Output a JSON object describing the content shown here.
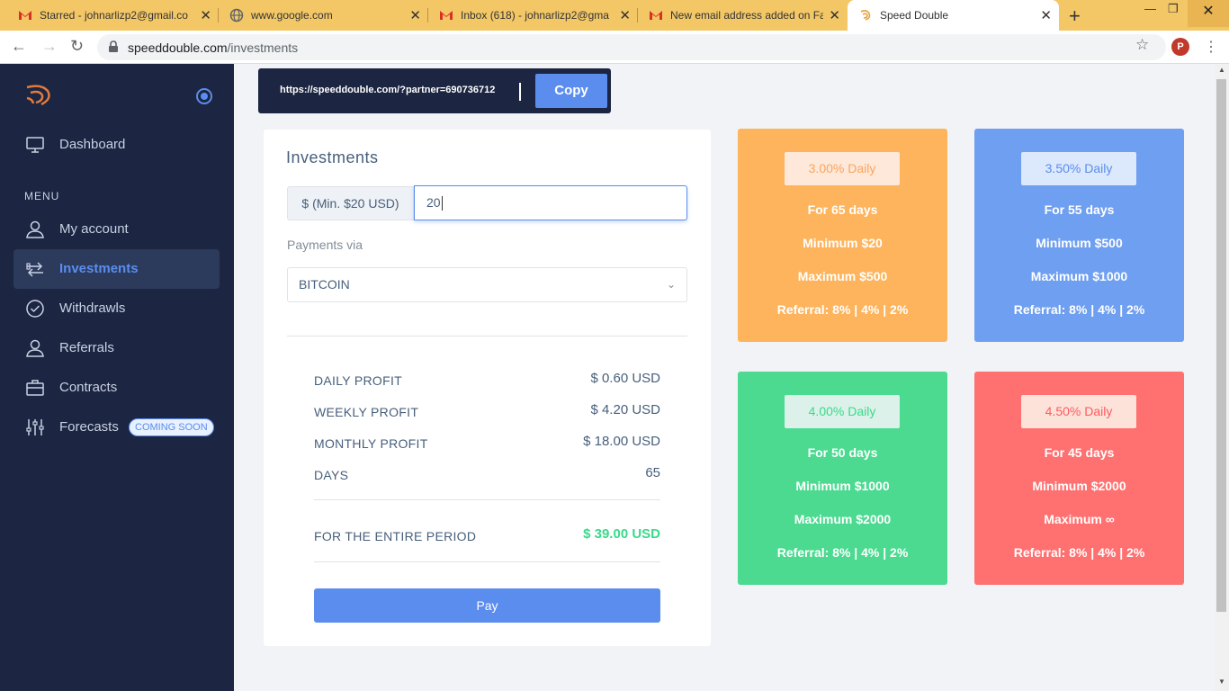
{
  "browser": {
    "tabs": [
      {
        "title": "Starred - johnarlizp2@gmail.co",
        "icon": "gmail-icon"
      },
      {
        "title": "www.google.com",
        "icon": "globe-icon"
      },
      {
        "title": "Inbox (618) - johnarlizp2@gma",
        "icon": "gmail-icon"
      },
      {
        "title": "New email address added on Fa",
        "icon": "gmail-icon"
      },
      {
        "title": "Speed Double",
        "icon": "speeddouble-icon"
      }
    ],
    "url_host": "speeddouble.com",
    "url_path": "/investments",
    "profile_initial": "P"
  },
  "sidebar": {
    "dashboard": "Dashboard",
    "menu_title": "MENU",
    "items": [
      {
        "label": "My account"
      },
      {
        "label": "Investments"
      },
      {
        "label": "Withdrawls"
      },
      {
        "label": "Referrals"
      },
      {
        "label": "Contracts"
      },
      {
        "label": "Forecasts"
      }
    ],
    "badge": "COMING SOON"
  },
  "referral": {
    "url": "https://speeddouble.com/?partner=690736712",
    "copy_label": "Copy"
  },
  "investments": {
    "title": "Investments",
    "amount_addon": "$ (Min. $20 USD)",
    "amount_value": "20",
    "payments_label": "Payments via",
    "payment_method": "BITCOIN",
    "rows": [
      {
        "label": "DAILY PROFIT",
        "value": "$ 0.60 USD"
      },
      {
        "label": "WEEKLY PROFIT",
        "value": "$ 4.20 USD"
      },
      {
        "label": "MONTHLY PROFIT",
        "value": "$ 18.00 USD"
      },
      {
        "label": "DAYS",
        "value": "65"
      }
    ],
    "total_label": "FOR THE ENTIRE PERIOD",
    "total_value": "$ 39.00 USD",
    "pay_label": "Pay"
  },
  "plans": [
    {
      "rate": "3.00% Daily",
      "days": "For 65 days",
      "min": "Minimum $20",
      "max": "Maximum $500",
      "referral": "Referral: 8% | 4% | 2%",
      "color": "#fdb45c"
    },
    {
      "rate": "3.50% Daily",
      "days": "For 55 days",
      "min": "Minimum $500",
      "max": "Maximum $1000",
      "referral": "Referral: 8% | 4% | 2%",
      "color": "#6f9ff0"
    },
    {
      "rate": "4.00% Daily",
      "days": "For 50 days",
      "min": "Minimum $1000",
      "max": "Maximum $2000",
      "referral": "Referral: 8% | 4% | 2%",
      "color": "#4bda90"
    },
    {
      "rate": "4.50% Daily",
      "days": "For 45 days",
      "min": "Minimum $2000",
      "max": "Maximum ∞",
      "referral": "Referral: 8% | 4% | 2%",
      "color": "#ff7171"
    }
  ],
  "colors": {
    "primary": "#5a8dee",
    "sidebar": "#1c2541",
    "success": "#39da8a"
  }
}
